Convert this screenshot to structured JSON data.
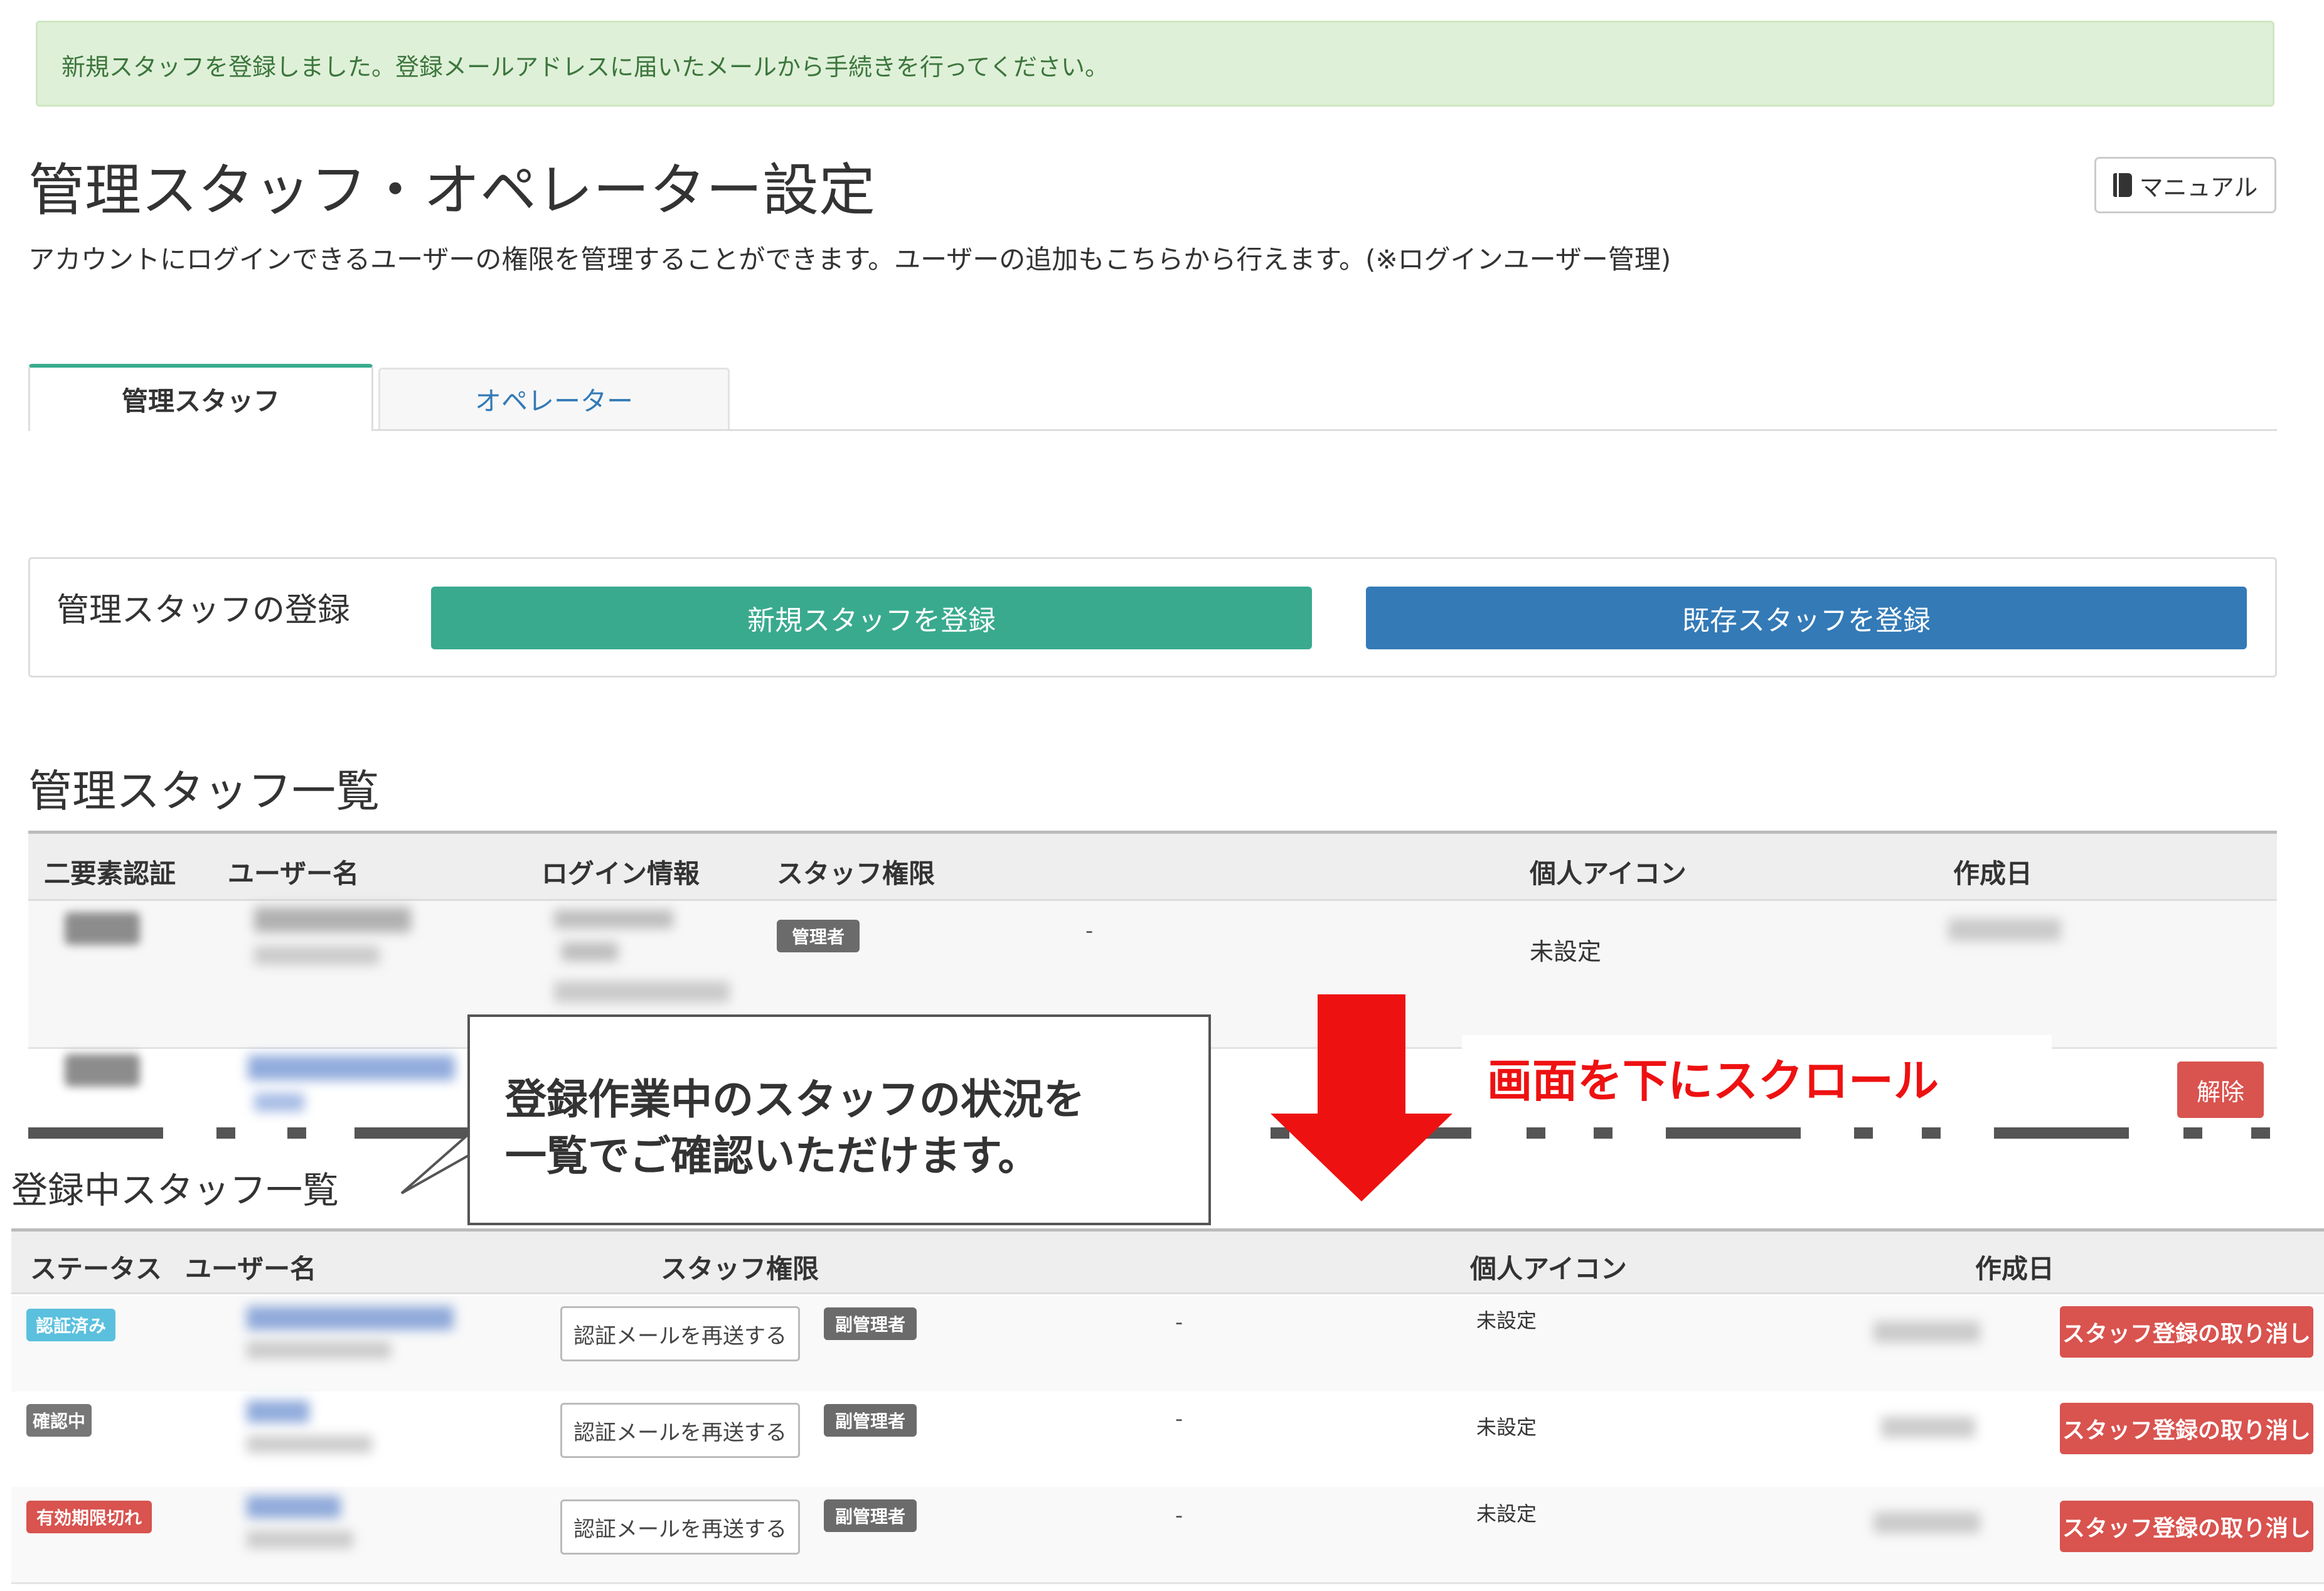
{
  "alert": {
    "message": "新規スタッフを登録しました。登録メールアドレスに届いたメールから手続きを行ってください。"
  },
  "header": {
    "title": "管理スタッフ・オペレーター設定",
    "description": "アカウントにログインできるユーザーの権限を管理することができます。ユーザーの追加もこちらから行えます。(※ログインユーザー管理)",
    "manual_label": "マニュアル"
  },
  "tabs": [
    {
      "label": "管理スタッフ",
      "active": true
    },
    {
      "label": "オペレーター",
      "active": false
    }
  ],
  "register_panel": {
    "label": "管理スタッフの登録",
    "new_button": "新規スタッフを登録",
    "existing_button": "既存スタッフを登録"
  },
  "staff_list": {
    "title": "管理スタッフ一覧",
    "columns": [
      "二要素認証",
      "ユーザー名",
      "ログイン情報",
      "スタッフ権限",
      "個人アイコン",
      "作成日"
    ],
    "rows": [
      {
        "role": "管理者",
        "extra": "-",
        "icon": "未設定"
      },
      {
        "release_label": "解除"
      }
    ]
  },
  "registering_list": {
    "title": "登録中スタッフ一覧",
    "columns": [
      "ステータス",
      "ユーザー名",
      "スタッフ権限",
      "個人アイコン",
      "作成日"
    ],
    "rows": [
      {
        "status": "認証済み",
        "resend": "認証メールを再送する",
        "role": "副管理者",
        "extra": "-",
        "icon": "未設定",
        "cancel": "スタッフ登録の取り消し"
      },
      {
        "status": "確認中",
        "resend": "認証メールを再送する",
        "role": "副管理者",
        "extra": "-",
        "icon": "未設定",
        "cancel": "スタッフ登録の取り消し"
      },
      {
        "status": "有効期限切れ",
        "resend": "認証メールを再送する",
        "role": "副管理者",
        "extra": "-",
        "icon": "未設定",
        "cancel": "スタッフ登録の取り消し"
      }
    ]
  },
  "annotation": {
    "callout_line1": "登録作業中のスタッフの状況を",
    "callout_line2": "一覧でご確認いただけます。",
    "scroll_note": "画面を下にスクロール"
  },
  "colors": {
    "accent_green": "#39aa8e",
    "primary_blue": "#337ab7",
    "danger_red": "#d9534f",
    "status_verified": "#5bc0de",
    "status_pending": "#777777",
    "status_expired": "#d9534f",
    "annotation_red": "#ee1111"
  }
}
